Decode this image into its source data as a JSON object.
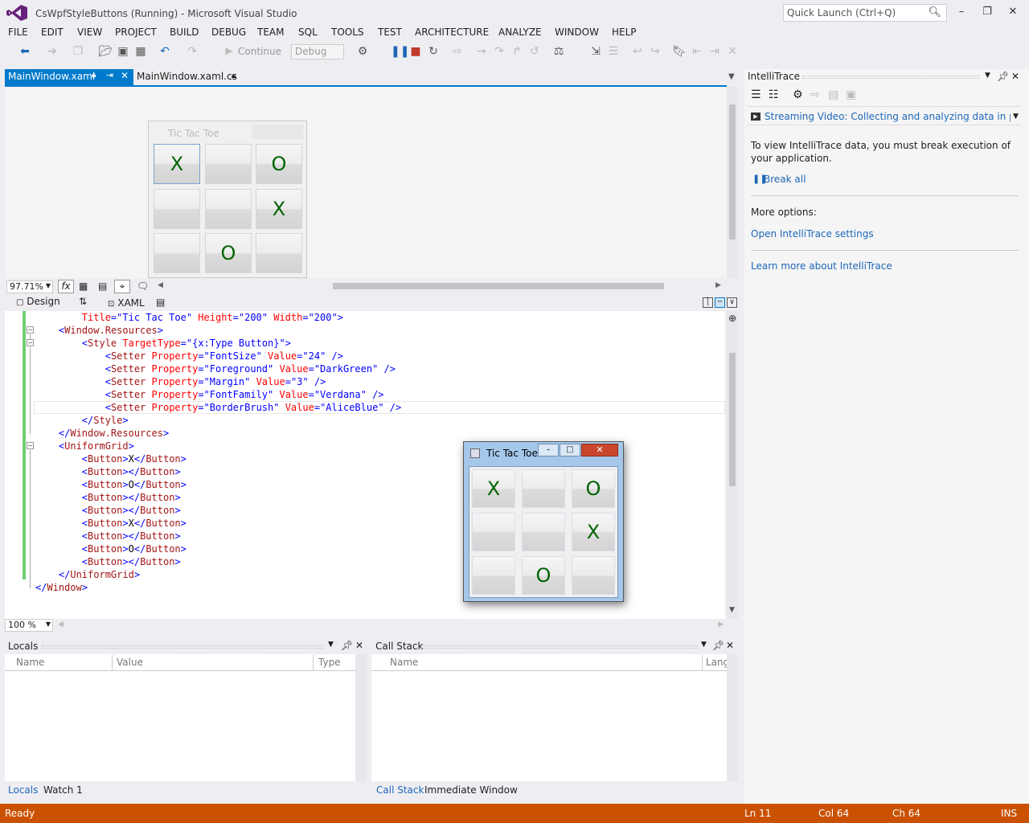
{
  "window": {
    "title": "CsWpfStyleButtons (Running) - Microsoft Visual Studio",
    "quick_launch_placeholder": "Quick Launch (Ctrl+Q)",
    "accent": "#007acc",
    "status_color": "#ca5100"
  },
  "menu": [
    "FILE",
    "EDIT",
    "VIEW",
    "PROJECT",
    "BUILD",
    "DEBUG",
    "TEAM",
    "SQL",
    "TOOLS",
    "TEST",
    "ARCHITECTURE",
    "ANALYZE",
    "WINDOW",
    "HELP"
  ],
  "toolbar": {
    "continue_label": "Continue",
    "config_value": "Debug"
  },
  "tabs": {
    "active": "MainWindow.xaml",
    "inactive": "MainWindow.xaml.cs"
  },
  "designer": {
    "window_title": "Tic Tac Toe",
    "cells": [
      "X",
      "",
      "O",
      "",
      "",
      "X",
      "",
      "O",
      ""
    ],
    "zoom": "97.71%"
  },
  "view_switch": {
    "design": "Design",
    "xaml": "XAML"
  },
  "code_lines": [
    [
      {
        "c": "t-tx",
        "t": "        "
      },
      {
        "c": "t-at",
        "t": "Title"
      },
      {
        "c": "t-pu",
        "t": "=\"Tic Tac Toe\" "
      },
      {
        "c": "t-at",
        "t": "Height"
      },
      {
        "c": "t-pu",
        "t": "=\"200\" "
      },
      {
        "c": "t-at",
        "t": "Width"
      },
      {
        "c": "t-pu",
        "t": "=\"200\">"
      }
    ],
    [
      {
        "c": "t-tx",
        "t": "    "
      },
      {
        "c": "t-pu",
        "t": "<"
      },
      {
        "c": "t-br",
        "t": "Window.Resources"
      },
      {
        "c": "t-pu",
        "t": ">"
      }
    ],
    [
      {
        "c": "t-tx",
        "t": "        "
      },
      {
        "c": "t-pu",
        "t": "<"
      },
      {
        "c": "t-br",
        "t": "Style"
      },
      {
        "c": "t-at",
        "t": " TargetType"
      },
      {
        "c": "t-pu",
        "t": "=\"{x:Type Button}\">"
      }
    ],
    [
      {
        "c": "t-tx",
        "t": "            "
      },
      {
        "c": "t-pu",
        "t": "<"
      },
      {
        "c": "t-br",
        "t": "Setter"
      },
      {
        "c": "t-at",
        "t": " Property"
      },
      {
        "c": "t-pu",
        "t": "=\"FontSize\""
      },
      {
        "c": "t-at",
        "t": " Value"
      },
      {
        "c": "t-pu",
        "t": "=\"24\" />"
      }
    ],
    [
      {
        "c": "t-tx",
        "t": "            "
      },
      {
        "c": "t-pu",
        "t": "<"
      },
      {
        "c": "t-br",
        "t": "Setter"
      },
      {
        "c": "t-at",
        "t": " Property"
      },
      {
        "c": "t-pu",
        "t": "=\"Foreground\""
      },
      {
        "c": "t-at",
        "t": " Value"
      },
      {
        "c": "t-pu",
        "t": "=\"DarkGreen\" />"
      }
    ],
    [
      {
        "c": "t-tx",
        "t": "            "
      },
      {
        "c": "t-pu",
        "t": "<"
      },
      {
        "c": "t-br",
        "t": "Setter"
      },
      {
        "c": "t-at",
        "t": " Property"
      },
      {
        "c": "t-pu",
        "t": "=\"Margin\""
      },
      {
        "c": "t-at",
        "t": " Value"
      },
      {
        "c": "t-pu",
        "t": "=\"3\" />"
      }
    ],
    [
      {
        "c": "t-tx",
        "t": "            "
      },
      {
        "c": "t-pu",
        "t": "<"
      },
      {
        "c": "t-br",
        "t": "Setter"
      },
      {
        "c": "t-at",
        "t": " Property"
      },
      {
        "c": "t-pu",
        "t": "=\"FontFamily\""
      },
      {
        "c": "t-at",
        "t": " Value"
      },
      {
        "c": "t-pu",
        "t": "=\"Verdana\" />"
      }
    ],
    [
      {
        "c": "t-tx",
        "t": "            "
      },
      {
        "c": "t-pu",
        "t": "<"
      },
      {
        "c": "t-br",
        "t": "Setter"
      },
      {
        "c": "t-at",
        "t": " Property"
      },
      {
        "c": "t-pu",
        "t": "=\"BorderBrush\""
      },
      {
        "c": "t-at",
        "t": " Value"
      },
      {
        "c": "t-pu",
        "t": "=\"AliceBlue\" />"
      }
    ],
    [
      {
        "c": "t-tx",
        "t": "        "
      },
      {
        "c": "t-pu",
        "t": "</"
      },
      {
        "c": "t-br",
        "t": "Style"
      },
      {
        "c": "t-pu",
        "t": ">"
      }
    ],
    [
      {
        "c": "t-tx",
        "t": "    "
      },
      {
        "c": "t-pu",
        "t": "</"
      },
      {
        "c": "t-br",
        "t": "Window.Resources"
      },
      {
        "c": "t-pu",
        "t": ">"
      }
    ],
    [
      {
        "c": "t-tx",
        "t": "    "
      },
      {
        "c": "t-pu",
        "t": "<"
      },
      {
        "c": "t-br",
        "t": "UniformGrid"
      },
      {
        "c": "t-pu",
        "t": ">"
      }
    ],
    [
      {
        "c": "t-tx",
        "t": "        "
      },
      {
        "c": "t-pu",
        "t": "<"
      },
      {
        "c": "t-br",
        "t": "Button"
      },
      {
        "c": "t-pu",
        "t": ">"
      },
      {
        "c": "t-tx",
        "t": "X"
      },
      {
        "c": "t-pu",
        "t": "</"
      },
      {
        "c": "t-br",
        "t": "Button"
      },
      {
        "c": "t-pu",
        "t": ">"
      }
    ],
    [
      {
        "c": "t-tx",
        "t": "        "
      },
      {
        "c": "t-pu",
        "t": "<"
      },
      {
        "c": "t-br",
        "t": "Button"
      },
      {
        "c": "t-pu",
        "t": "></"
      },
      {
        "c": "t-br",
        "t": "Button"
      },
      {
        "c": "t-pu",
        "t": ">"
      }
    ],
    [
      {
        "c": "t-tx",
        "t": "        "
      },
      {
        "c": "t-pu",
        "t": "<"
      },
      {
        "c": "t-br",
        "t": "Button"
      },
      {
        "c": "t-pu",
        "t": ">"
      },
      {
        "c": "t-tx",
        "t": "O"
      },
      {
        "c": "t-pu",
        "t": "</"
      },
      {
        "c": "t-br",
        "t": "Button"
      },
      {
        "c": "t-pu",
        "t": ">"
      }
    ],
    [
      {
        "c": "t-tx",
        "t": "        "
      },
      {
        "c": "t-pu",
        "t": "<"
      },
      {
        "c": "t-br",
        "t": "Button"
      },
      {
        "c": "t-pu",
        "t": "></"
      },
      {
        "c": "t-br",
        "t": "Button"
      },
      {
        "c": "t-pu",
        "t": ">"
      }
    ],
    [
      {
        "c": "t-tx",
        "t": "        "
      },
      {
        "c": "t-pu",
        "t": "<"
      },
      {
        "c": "t-br",
        "t": "Button"
      },
      {
        "c": "t-pu",
        "t": "></"
      },
      {
        "c": "t-br",
        "t": "Button"
      },
      {
        "c": "t-pu",
        "t": ">"
      }
    ],
    [
      {
        "c": "t-tx",
        "t": "        "
      },
      {
        "c": "t-pu",
        "t": "<"
      },
      {
        "c": "t-br",
        "t": "Button"
      },
      {
        "c": "t-pu",
        "t": ">"
      },
      {
        "c": "t-tx",
        "t": "X"
      },
      {
        "c": "t-pu",
        "t": "</"
      },
      {
        "c": "t-br",
        "t": "Button"
      },
      {
        "c": "t-pu",
        "t": ">"
      }
    ],
    [
      {
        "c": "t-tx",
        "t": "        "
      },
      {
        "c": "t-pu",
        "t": "<"
      },
      {
        "c": "t-br",
        "t": "Button"
      },
      {
        "c": "t-pu",
        "t": "></"
      },
      {
        "c": "t-br",
        "t": "Button"
      },
      {
        "c": "t-pu",
        "t": ">"
      }
    ],
    [
      {
        "c": "t-tx",
        "t": "        "
      },
      {
        "c": "t-pu",
        "t": "<"
      },
      {
        "c": "t-br",
        "t": "Button"
      },
      {
        "c": "t-pu",
        "t": ">"
      },
      {
        "c": "t-tx",
        "t": "O"
      },
      {
        "c": "t-pu",
        "t": "</"
      },
      {
        "c": "t-br",
        "t": "Button"
      },
      {
        "c": "t-pu",
        "t": ">"
      }
    ],
    [
      {
        "c": "t-tx",
        "t": "        "
      },
      {
        "c": "t-pu",
        "t": "<"
      },
      {
        "c": "t-br",
        "t": "Button"
      },
      {
        "c": "t-pu",
        "t": "></"
      },
      {
        "c": "t-br",
        "t": "Button"
      },
      {
        "c": "t-pu",
        "t": ">"
      }
    ],
    [
      {
        "c": "t-tx",
        "t": "    "
      },
      {
        "c": "t-pu",
        "t": "</"
      },
      {
        "c": "t-br",
        "t": "UniformGrid"
      },
      {
        "c": "t-pu",
        "t": ">"
      }
    ],
    [
      {
        "c": "t-pu",
        "t": "</"
      },
      {
        "c": "t-br",
        "t": "Window"
      },
      {
        "c": "t-pu",
        "t": ">"
      }
    ]
  ],
  "editor_zoom": "100 %",
  "locals": {
    "title": "Locals",
    "columns": [
      "Name",
      "Value",
      "Type"
    ],
    "tabs": [
      "Locals",
      "Watch 1"
    ]
  },
  "callstack": {
    "title": "Call Stack",
    "columns": [
      "Name",
      "Lang"
    ],
    "tabs": [
      "Call Stack",
      "Immediate Window"
    ]
  },
  "intellitrace": {
    "title": "IntelliTrace",
    "video": "Streaming Video: Collecting and analyzing data in product",
    "info": "To view IntelliTrace data, you must break execution of your application.",
    "break_all": "Break all",
    "more_options": "More options:",
    "settings_link": "Open IntelliTrace settings",
    "learn_link": "Learn more about IntelliTrace"
  },
  "running_app": {
    "title": "Tic Tac Toe",
    "cells": [
      "X",
      "",
      "O",
      "",
      "",
      "X",
      "",
      "O",
      ""
    ]
  },
  "status": {
    "ready": "Ready",
    "ln": "Ln 11",
    "col": "Col 64",
    "ch": "Ch 64",
    "mode": "INS"
  }
}
